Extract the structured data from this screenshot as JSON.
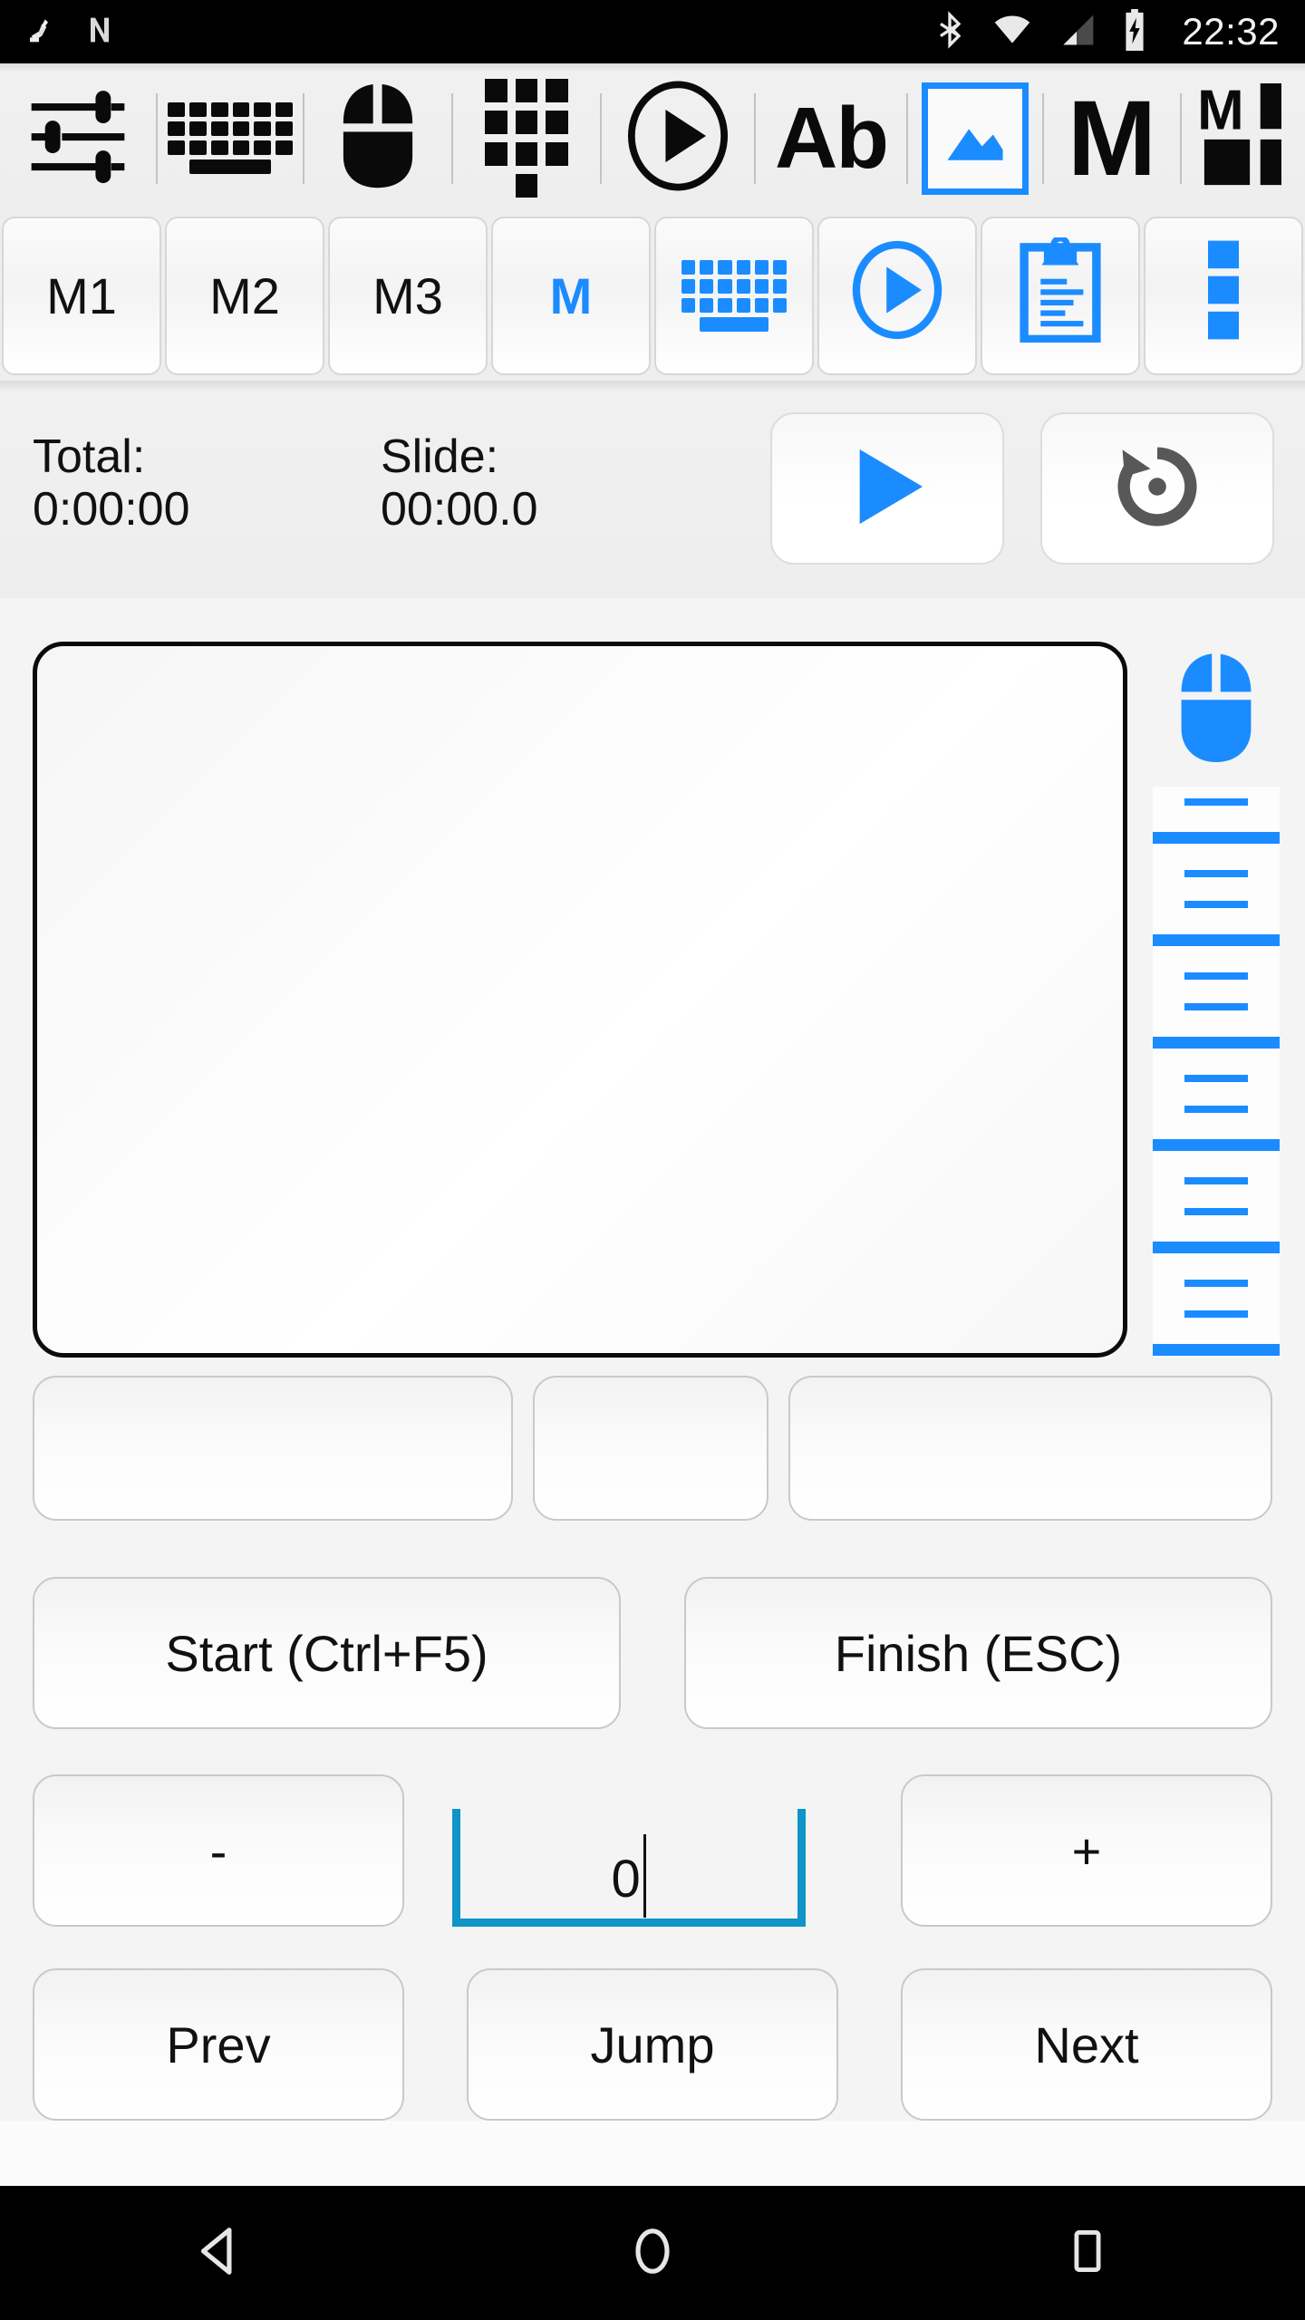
{
  "status_bar": {
    "time": "22:32",
    "icons": [
      "developer-mode-icon",
      "nfc-icon",
      "bluetooth-icon",
      "wifi-icon",
      "cellular-signal-icon",
      "battery-charging-icon"
    ]
  },
  "toolbar_primary": {
    "items": [
      {
        "name": "settings-sliders-icon",
        "label": "Settings",
        "selected": false
      },
      {
        "name": "keyboard-icon",
        "label": "Keyboard",
        "selected": false
      },
      {
        "name": "mouse-icon",
        "label": "Mouse",
        "selected": false
      },
      {
        "name": "numpad-icon",
        "label": "Numpad",
        "selected": false
      },
      {
        "name": "media-play-icon",
        "label": "Media",
        "selected": false
      },
      {
        "name": "text-ab-icon",
        "label": "Ab",
        "selected": false
      },
      {
        "name": "presentation-image-icon",
        "label": "Presentation",
        "selected": true
      },
      {
        "name": "macro-m-icon",
        "label": "M",
        "selected": false
      },
      {
        "name": "macro-grid-icon",
        "label": "M Grid",
        "selected": false
      }
    ]
  },
  "toolbar_secondary": {
    "items": [
      {
        "name": "macro-m1-button",
        "label": "M1",
        "type": "text",
        "color": "#111111"
      },
      {
        "name": "macro-m2-button",
        "label": "M2",
        "type": "text",
        "color": "#111111"
      },
      {
        "name": "macro-m3-button",
        "label": "M3",
        "type": "text",
        "color": "#111111"
      },
      {
        "name": "macro-m-button",
        "label": "M",
        "type": "text",
        "color": "#1a8cff"
      },
      {
        "name": "keyboard-button",
        "label": "",
        "type": "keyboard-icon",
        "color": "#1a8cff"
      },
      {
        "name": "media-play-button",
        "label": "",
        "type": "play-circle-icon",
        "color": "#1a8cff"
      },
      {
        "name": "clipboard-button",
        "label": "",
        "type": "clipboard-icon",
        "color": "#1a8cff"
      },
      {
        "name": "overflow-menu-button",
        "label": "",
        "type": "more-vertical-icon",
        "color": "#1a8cff"
      }
    ]
  },
  "timer": {
    "total_label": "Total:",
    "total_value": "0:00:00",
    "slide_label": "Slide:",
    "slide_value": "00:00.0",
    "play_button": "play-icon",
    "reset_button": "reset-icon"
  },
  "touchpad": {
    "name": "touchpad-surface",
    "scroll_wheel_icon": "mouse-icon",
    "scroll_strip": "scroll-wheel-strip"
  },
  "mouse_buttons": [
    {
      "name": "mouse-left-button",
      "label": ""
    },
    {
      "name": "mouse-middle-button",
      "label": ""
    },
    {
      "name": "mouse-right-button",
      "label": ""
    }
  ],
  "presentation_controls": {
    "start_label": "Start (Ctrl+F5)",
    "finish_label": "Finish (ESC)",
    "minus_label": "-",
    "plus_label": "+",
    "slide_number_value": "0",
    "slide_number_placeholder": "0",
    "prev_label": "Prev",
    "jump_label": "Jump",
    "next_label": "Next"
  },
  "nav_bar": {
    "back": "back-icon",
    "home": "home-icon",
    "recents": "recents-icon"
  },
  "colors": {
    "accent_blue": "#1a8cff",
    "underline_teal": "#0f95c8",
    "toolbar_bg": "#eeeeee",
    "page_bg": "#f4f4f4",
    "black": "#000000"
  }
}
